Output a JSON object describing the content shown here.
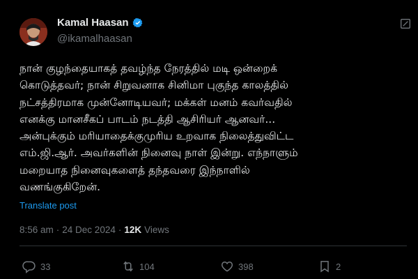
{
  "author": {
    "name": "Kamal Haasan",
    "handle": "@ikamalhaasan",
    "avatar_icon": "profile-avatar",
    "verified_color": "#1d9bf0"
  },
  "tweet": {
    "lines": [
      "நான் குழந்தையாகத் தவழ்ந்த நேரத்தில் மடி ஒன்றைக்",
      "கொடுத்தவர்; நான் சிறுவனாக சினிமா புகுந்த காலத்தில்",
      "நட்சத்திரமாக முன்னோடியவர்; மக்கள் மனம் கவர்வதில்",
      "எனக்கு மானசீகப் பாடம் நடத்தி ஆசிரியர் ஆனவர்...",
      "அன்புக்கும் மரியாதைக்குமுரிய உறவாக நிலைத்துவிட்ட",
      "எம்.ஜி.ஆர். அவர்களின் நினைவு நாள் இன்று. எந்நாளும்",
      "மறையாத நினைவுகளைத் தந்தவரை இந்நாளில்",
      "வணங்குகிறேன்."
    ],
    "translate_label": "Translate post",
    "time": "8:56 am",
    "separator": "·",
    "date": "24 Dec 2024",
    "views_count": "12K",
    "views_label": "Views"
  },
  "actions": {
    "replies": "33",
    "reposts": "104",
    "likes": "398",
    "bookmarks": "2"
  },
  "colors": {
    "background": "#000000",
    "text": "#e7e9ea",
    "muted": "#71767b",
    "accent": "#1d9bf0"
  }
}
